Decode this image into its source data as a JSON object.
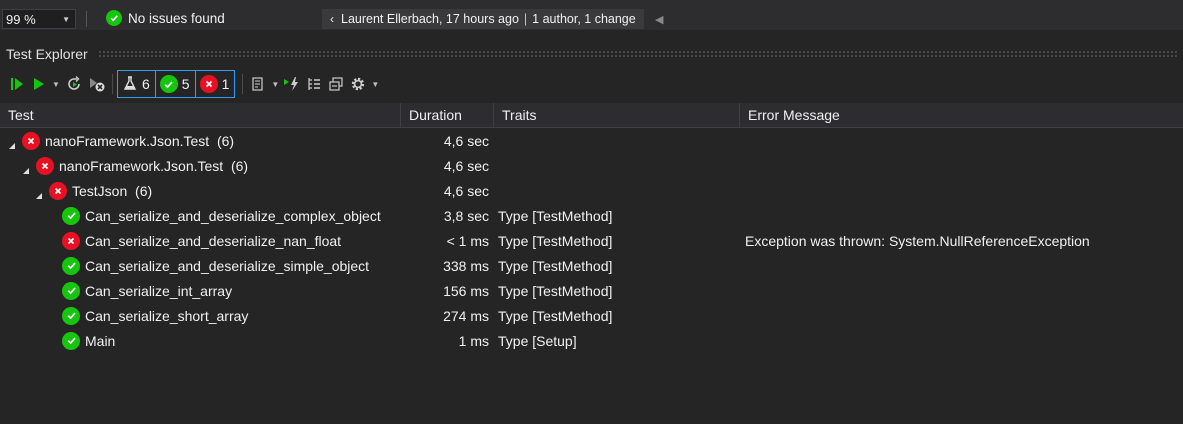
{
  "statusbar": {
    "zoom": "99 %",
    "issues": "No issues found",
    "git_author_time": "Laurent Ellerbach, 17 hours ago",
    "git_changes": "1 author, 1 change"
  },
  "panel": {
    "title": "Test Explorer"
  },
  "toolbar": {
    "total_count": "6",
    "passed_count": "5",
    "failed_count": "1"
  },
  "columns": {
    "test": "Test",
    "duration": "Duration",
    "traits": "Traits",
    "error": "Error Message"
  },
  "tests": [
    {
      "name": "nanoFramework.Json.Test",
      "count": "(6)",
      "status": "fail",
      "level": 0,
      "expanded": true,
      "duration": "4,6 sec",
      "traits": "",
      "error": ""
    },
    {
      "name": "nanoFramework.Json.Test",
      "count": "(6)",
      "status": "fail",
      "level": 1,
      "expanded": true,
      "duration": "4,6 sec",
      "traits": "",
      "error": ""
    },
    {
      "name": "TestJson",
      "count": "(6)",
      "status": "fail",
      "level": 2,
      "expanded": true,
      "duration": "4,6 sec",
      "traits": "",
      "error": ""
    },
    {
      "name": "Can_serialize_and_deserialize_complex_object",
      "count": "",
      "status": "pass",
      "level": 3,
      "duration": "3,8 sec",
      "traits": "Type [TestMethod]",
      "error": ""
    },
    {
      "name": "Can_serialize_and_deserialize_nan_float",
      "count": "",
      "status": "fail",
      "level": 3,
      "duration": "< 1 ms",
      "traits": "Type [TestMethod]",
      "error": "Exception was thrown: System.NullReferenceException"
    },
    {
      "name": "Can_serialize_and_deserialize_simple_object",
      "count": "",
      "status": "pass",
      "level": 3,
      "duration": "338 ms",
      "traits": "Type [TestMethod]",
      "error": ""
    },
    {
      "name": "Can_serialize_int_array",
      "count": "",
      "status": "pass",
      "level": 3,
      "duration": "156 ms",
      "traits": "Type [TestMethod]",
      "error": ""
    },
    {
      "name": "Can_serialize_short_array",
      "count": "",
      "status": "pass",
      "level": 3,
      "duration": "274 ms",
      "traits": "Type [TestMethod]",
      "error": ""
    },
    {
      "name": "Main",
      "count": "",
      "status": "pass",
      "level": 3,
      "duration": "1 ms",
      "traits": "Type [Setup]",
      "error": ""
    }
  ],
  "colors": {
    "pass": "#16c60c",
    "fail": "#e81123",
    "accent": "#3399ff",
    "background": "#252526"
  }
}
